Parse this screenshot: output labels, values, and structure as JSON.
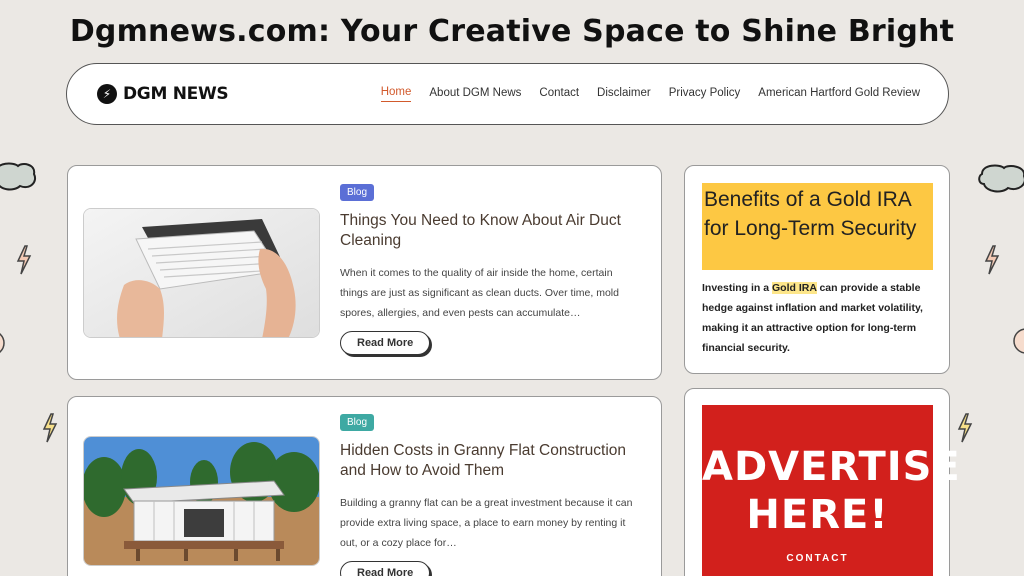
{
  "banner": {
    "title": "Dgmnews.com: Your Creative Space to Shine Bright"
  },
  "header": {
    "logo_text": "DGM NEWS",
    "nav": [
      {
        "label": "Home",
        "active": true
      },
      {
        "label": "About DGM News",
        "active": false
      },
      {
        "label": "Contact",
        "active": false
      },
      {
        "label": "Disclaimer",
        "active": false
      },
      {
        "label": "Privacy Policy",
        "active": false
      },
      {
        "label": "American Hartford Gold Review",
        "active": false
      }
    ]
  },
  "posts": [
    {
      "category": "Blog",
      "category_color": "#5b6fd6",
      "title": "Things You Need to Know About Air Duct Cleaning",
      "excerpt": "When it comes to the quality of air inside the home, certain things are just as significant as clean ducts. Over time, mold spores, allergies, and even pests can accumulate…",
      "read_more": "Read More",
      "image_icon": "air-vent-photo"
    },
    {
      "category": "Blog",
      "category_color": "#3ea9a3",
      "title": "Hidden Costs in Granny Flat Construction and How to Avoid Them",
      "excerpt": "Building a granny flat can be a great investment because it can provide extra living space, a place to earn money by renting it out, or a cozy place for…",
      "read_more": "Read More",
      "image_icon": "granny-flat-photo"
    }
  ],
  "sidebar": {
    "promo": {
      "title": "Benefits of a Gold IRA for Long-Term Security",
      "text_before": "Investing in a ",
      "text_highlight": "Gold IRA",
      "text_after": " can provide a stable hedge against inflation and market volatility, making it an attractive option for long-term financial security.",
      "background_color": "#fdc843"
    },
    "ad": {
      "line1": "ADVERTISE",
      "line2": "HERE!",
      "line3": "CONTACT",
      "background_color": "#d2201c"
    }
  }
}
